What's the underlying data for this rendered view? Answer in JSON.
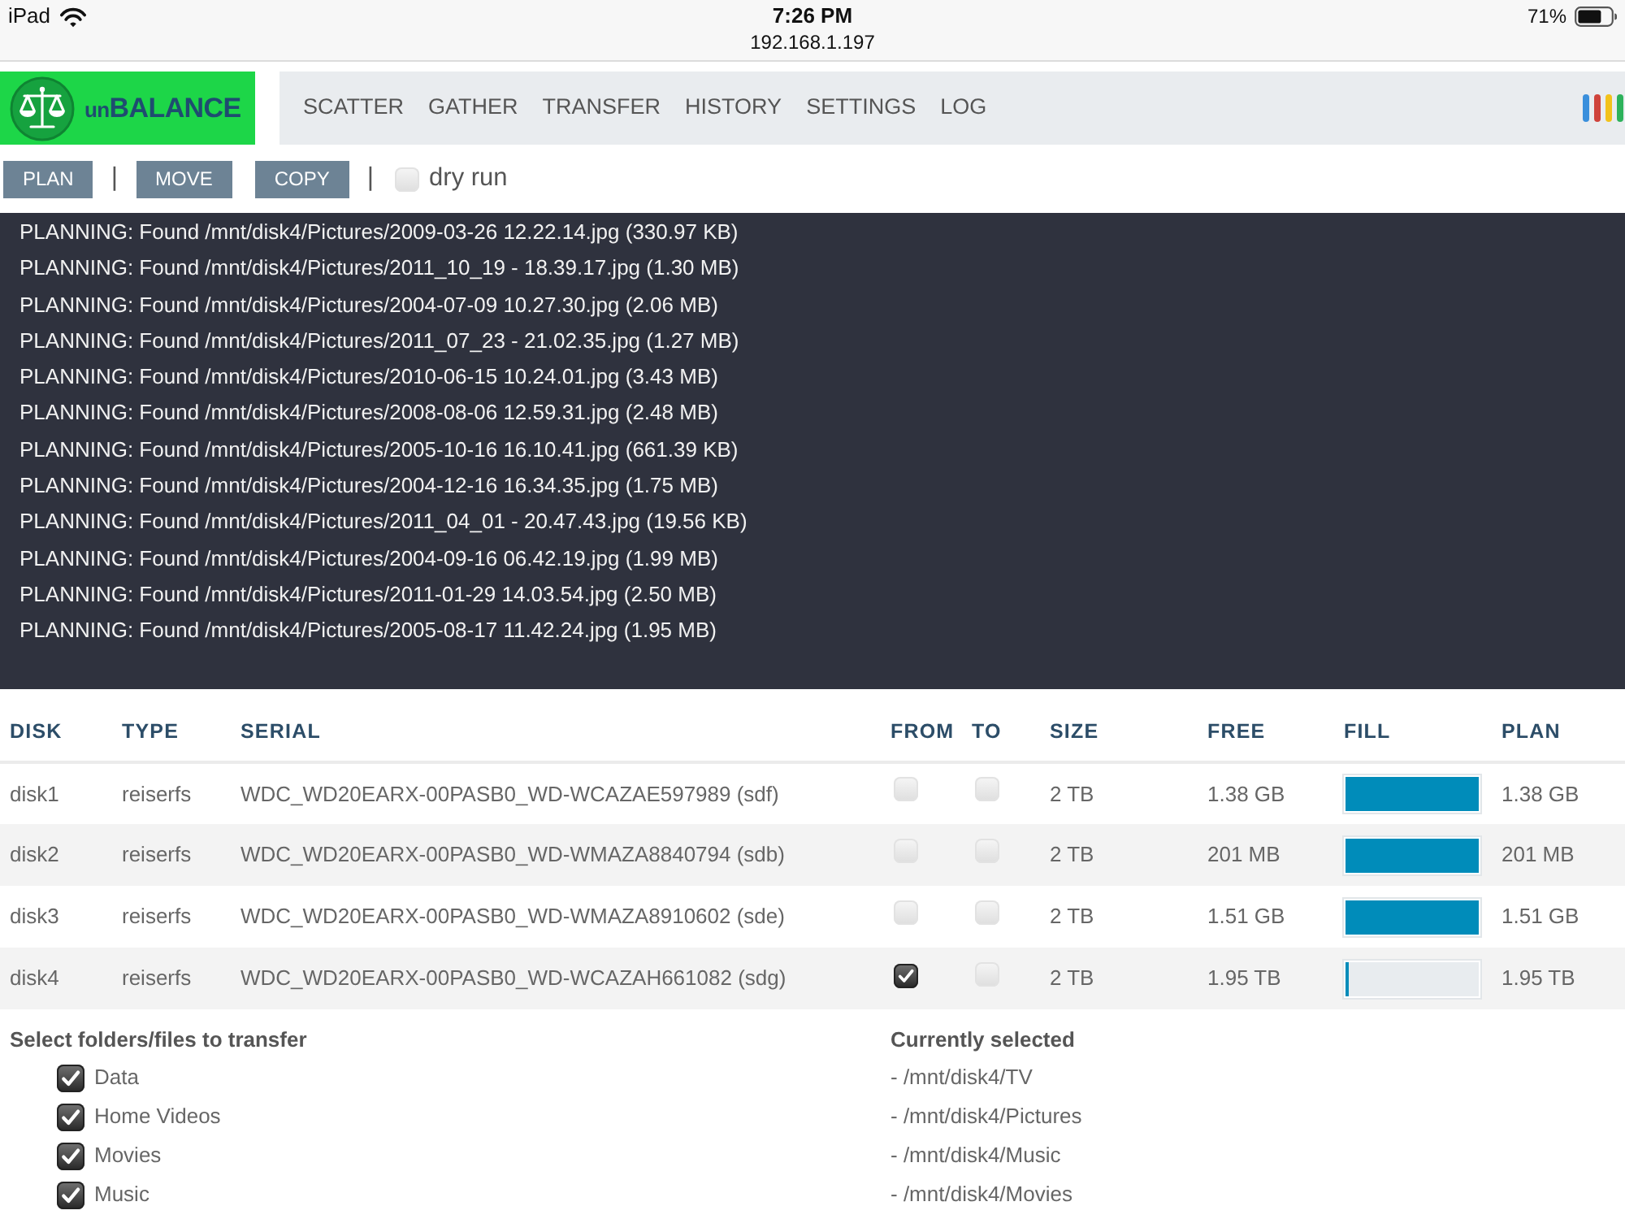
{
  "status_bar": {
    "device": "iPad",
    "time": "7:26 PM",
    "address": "192.168.1.197",
    "battery": "71%"
  },
  "header": {
    "logo": {
      "prefix": "un",
      "name": "BALANCE"
    },
    "nav": [
      {
        "label": "SCATTER",
        "selected": false
      },
      {
        "label": "GATHER",
        "selected": false
      },
      {
        "label": "TRANSFER",
        "selected": false
      },
      {
        "label": "HISTORY",
        "selected": false
      },
      {
        "label": "SETTINGS",
        "selected": false
      },
      {
        "label": "LOG",
        "selected": false
      }
    ]
  },
  "toolbar": [
    {
      "kind": "button",
      "label": "PLAN"
    },
    {
      "kind": "separator",
      "text": "|"
    },
    {
      "kind": "button",
      "label": "MOVE"
    },
    {
      "kind": "button",
      "label": "COPY"
    },
    {
      "kind": "separator",
      "text": "|"
    },
    {
      "kind": "checkbox",
      "label": "dry run",
      "checked": false
    }
  ],
  "console": {
    "lines": [
      "PLANNING: Found /mnt/disk4/Pictures/2009-03-26 12.22.14.jpg (330.97 KB)",
      "PLANNING: Found /mnt/disk4/Pictures/2011_10_19 - 18.39.17.jpg (1.30 MB)",
      "PLANNING: Found /mnt/disk4/Pictures/2004-07-09 10.27.30.jpg (2.06 MB)",
      "PLANNING: Found /mnt/disk4/Pictures/2011_07_23 - 21.02.35.jpg (1.27 MB)",
      "PLANNING: Found /mnt/disk4/Pictures/2010-06-15 10.24.01.jpg (3.43 MB)",
      "PLANNING: Found /mnt/disk4/Pictures/2008-08-06 12.59.31.jpg (2.48 MB)",
      "PLANNING: Found /mnt/disk4/Pictures/2005-10-16 16.10.41.jpg (661.39 KB)",
      "PLANNING: Found /mnt/disk4/Pictures/2004-12-16 16.34.35.jpg (1.75 MB)",
      "PLANNING: Found /mnt/disk4/Pictures/2011_04_01 - 20.47.43.jpg (19.56 KB)",
      "PLANNING: Found /mnt/disk4/Pictures/2004-09-16 06.42.19.jpg (1.99 MB)",
      "PLANNING: Found /mnt/disk4/Pictures/2011-01-29 14.03.54.jpg (2.50 MB)",
      "PLANNING: Found /mnt/disk4/Pictures/2005-08-17 11.42.24.jpg (1.95 MB)"
    ]
  },
  "disks": {
    "columns": [
      "DISK",
      "TYPE",
      "SERIAL",
      "FROM",
      "TO",
      "SIZE",
      "FREE",
      "FILL",
      "PLAN"
    ],
    "rows": [
      {
        "disk": "disk1",
        "type": "reiserfs",
        "serial": "WDC_WD20EARX-00PASB0_WD-WCAZAE597989 (sdf)",
        "from": false,
        "to": false,
        "size": "2 TB",
        "free": "1.38 GB",
        "level": 1,
        "plan": "1.38 GB"
      },
      {
        "disk": "disk2",
        "type": "reiserfs",
        "serial": "WDC_WD20EARX-00PASB0_WD-WMAZA8840794 (sdb)",
        "from": false,
        "to": false,
        "size": "2 TB",
        "free": "201 MB",
        "level": 1,
        "plan": "201 MB"
      },
      {
        "disk": "disk3",
        "type": "reiserfs",
        "serial": "WDC_WD20EARX-00PASB0_WD-WMAZA8910602 (sde)",
        "from": false,
        "to": false,
        "size": "2 TB",
        "free": "1.51 GB",
        "level": 1,
        "plan": "1.51 GB"
      },
      {
        "disk": "disk4",
        "type": "reiserfs",
        "serial": "WDC_WD20EARX-00PASB0_WD-WCAZAH661082 (sdg)",
        "from": true,
        "to": false,
        "size": "2 TB",
        "free": "1.95 TB",
        "level": 0.03,
        "plan": "1.95 TB"
      }
    ]
  },
  "folders": {
    "title": "Select folders/files to transfer",
    "items": [
      {
        "label": "Data",
        "checked": true
      },
      {
        "label": "Home Videos",
        "checked": true
      },
      {
        "label": "Movies",
        "checked": true
      },
      {
        "label": "Music",
        "checked": true
      }
    ]
  },
  "selection": {
    "title": "Currently selected",
    "items": [
      "- /mnt/disk4/TV",
      "- /mnt/disk4/Pictures",
      "- /mnt/disk4/Music",
      "- /mnt/disk4/Movies"
    ]
  }
}
